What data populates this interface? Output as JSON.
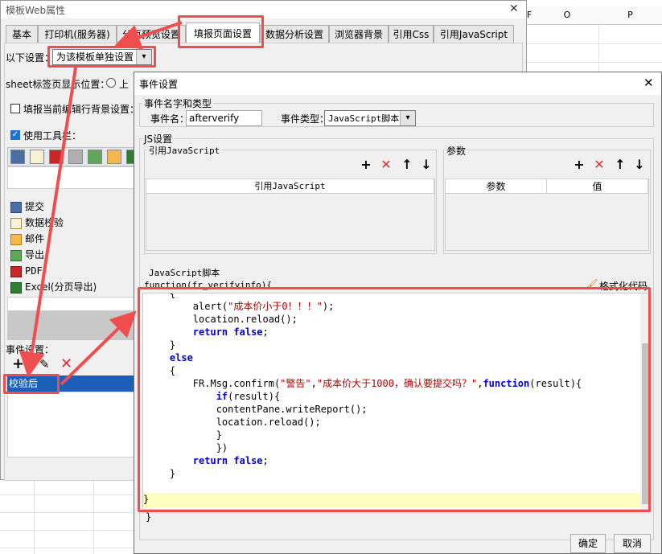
{
  "sheet": {
    "col_o": "O",
    "col_p": "P",
    "col_f": "F"
  },
  "outer_window": {
    "title": "模板Web属性",
    "close": "✕",
    "tabs": [
      "基本",
      "打印机(服务器)",
      "分页预览设置",
      "填报页面设置",
      "数据分析设置",
      "浏览器背景",
      "引用Css",
      "引用JavaScript"
    ],
    "settings_label": "以下设置：",
    "settings_value": "为该模板单独设置",
    "sheet_tab_label": "sheet标签页显示位置：",
    "radio_top": "上",
    "highlight_label": "填报当前编辑行背景设置：",
    "use_toolbar_label": "使用工具栏：",
    "list_items": [
      "提交",
      "数据校验",
      "邮件",
      "导出",
      "PDF",
      "Excel(分页导出)"
    ],
    "event_label": "事件设置：",
    "event_selected": "校验后"
  },
  "dialog": {
    "title": "事件设置",
    "close": "✕",
    "group_name": "事件名字和类型",
    "event_name_label": "事件名：",
    "event_name_value": "afterverify",
    "event_type_label": "事件类型：",
    "event_type_value": "JavaScript脚本",
    "js_group": "JS设置",
    "ref_js_label": "引用JavaScript",
    "params_label": "参数",
    "ref_js_header": "引用JavaScript",
    "param_header": "参数",
    "value_header": "值",
    "script_label": "JavaScript脚本",
    "format_label": "格式化代码",
    "code_first": "function(fr_verifyinfo){",
    "code_last": "}",
    "ok": "确定",
    "cancel": "取消"
  },
  "code_lines": [
    [
      "    {"
    ],
    [
      "        alert(",
      "\"成本价小于0！！！\"",
      ");"
    ],
    [
      "        location.reload();"
    ],
    [
      "        ",
      "return",
      " ",
      "false",
      ";"
    ],
    [
      "    }"
    ],
    [
      "    ",
      "else"
    ],
    [
      "    {"
    ],
    [
      "        FR.Msg.confirm(",
      "\"警告\"",
      ",",
      "\"成本价大于1000，确认要提交吗？\"",
      ",",
      "function",
      "(result){"
    ],
    [
      "            ",
      "if",
      "(result){"
    ],
    [
      "            contentPane.writeReport();"
    ],
    [
      "            location.reload();"
    ],
    [
      "            }"
    ],
    [
      "            })"
    ],
    [
      "        ",
      "return",
      " ",
      "false",
      ";"
    ],
    [
      "    }"
    ],
    [
      ""
    ],
    [
      "}"
    ]
  ],
  "colors": {
    "annotation": "#f04e4e",
    "selection": "#1c5fb8",
    "keyword": "#0000d0",
    "string": "#b00000",
    "highlight_line": "#ffffc0"
  }
}
